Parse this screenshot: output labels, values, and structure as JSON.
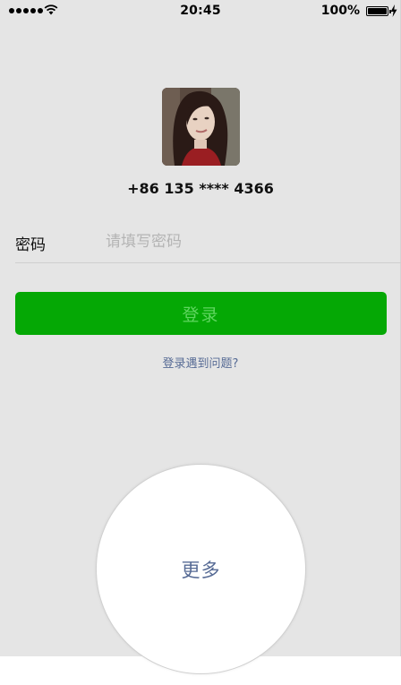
{
  "status_bar": {
    "time": "20:45",
    "battery_percent": "100%",
    "signal_icon": "signal-dots-icon",
    "wifi_icon": "wifi-icon",
    "battery_icon": "battery-icon",
    "charging_icon": "charging-bolt-icon"
  },
  "profile": {
    "phone": "+86 135 **** 4366"
  },
  "password": {
    "label": "密码",
    "placeholder": "请填写密码",
    "value": ""
  },
  "login": {
    "button_label": "登录",
    "trouble_link": "登录遇到问题?"
  },
  "more": {
    "label": "更多"
  },
  "colors": {
    "background": "#e5e5e5",
    "login_button": "#05a805",
    "login_button_text": "#5fd65f",
    "link": "#576b95"
  }
}
